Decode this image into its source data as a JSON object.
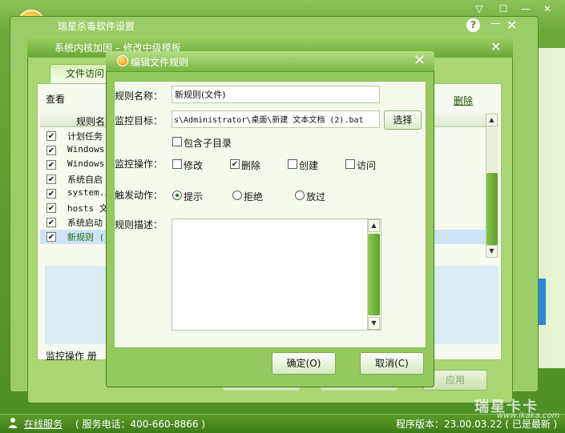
{
  "main_window": {
    "title": "瑞星杀毒软件设置",
    "help_label": "?",
    "min_label": "—",
    "close_label": "✕",
    "top_controls": [
      "▽",
      "☐",
      "—",
      "✕"
    ]
  },
  "kernel_window": {
    "title": "系统内核加固  –  修改中级模板",
    "close_label": "✕",
    "tab_label": "文件访问",
    "view_label": "查看",
    "delete_label": "删除",
    "list_header": "规则名",
    "rows": [
      {
        "checked": true,
        "text": "计划任务"
      },
      {
        "checked": true,
        "text": "Windows"
      },
      {
        "checked": true,
        "text": "Windows"
      },
      {
        "checked": true,
        "text": "系统自启"
      },
      {
        "checked": true,
        "text": "system.i"
      },
      {
        "checked": true,
        "text": "hosts 文"
      },
      {
        "checked": true,
        "text": "系统启动"
      },
      {
        "checked": true,
        "text": "新规则 ("
      }
    ],
    "monitor_op_label": "监控操作    册",
    "apply_label": "应用"
  },
  "rule_dialog": {
    "title": "编辑文件规则",
    "close_label": "✕",
    "name_label": "规则名称：",
    "name_value": "新规则(文件)",
    "target_label": "监控目标：",
    "target_value": "s\\Administrator\\桌面\\新建 文本文档 (2).bat",
    "choose_label": "选择",
    "include_sub_label": "包含子目录",
    "include_sub_checked": false,
    "ops_label": "监控操作：",
    "ops": [
      {
        "label": "修改",
        "checked": false
      },
      {
        "label": "删除",
        "checked": true
      },
      {
        "label": "创建",
        "checked": false
      },
      {
        "label": "访问",
        "checked": false
      }
    ],
    "trigger_label": "触发动作：",
    "triggers": [
      {
        "label": "提示",
        "selected": true
      },
      {
        "label": "拒绝",
        "selected": false
      },
      {
        "label": "放过",
        "selected": false
      }
    ],
    "desc_label": "规则描述：",
    "desc_value": "",
    "ok_label": "确定(O)",
    "cancel_label": "取消(C)"
  },
  "statusbar": {
    "online_service": "在线服务",
    "phone": "( 服务电话：400-660-8866 )",
    "version": "程序版本：23.00.03.22 ( 已是最新 )"
  },
  "watermark": {
    "brand": "瑞星卡卡",
    "url": "www.ikaka.com"
  },
  "colors": {
    "accent_green": "#6aa83a",
    "dark_green": "#3d7c17",
    "selection_blue": "#cde3f6"
  }
}
